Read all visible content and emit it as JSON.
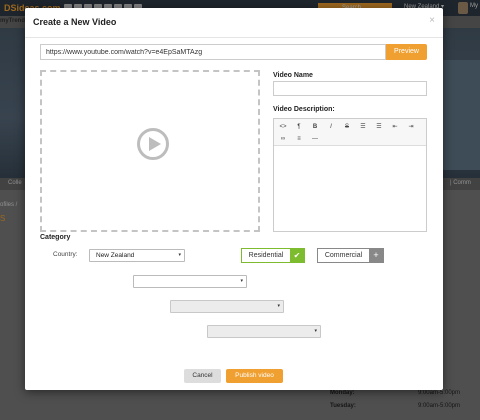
{
  "background": {
    "logo": "DSideas.com",
    "search_label": "Search",
    "country": "New Zealand ▾",
    "user": "My",
    "nav_label": "myTrends",
    "tab_left": "Colle",
    "tab_right": "| Comm",
    "crumb": "ofiles / ",
    "side_mark": "S",
    "hours": [
      {
        "day": "Monday:",
        "time": "9:00am-5:00pm"
      },
      {
        "day": "Tuesday:",
        "time": "9:00am-5:00pm"
      }
    ]
  },
  "modal": {
    "title": "Create a New Video",
    "close_glyph": "×",
    "url_value": "https://www.youtube.com/watch?v=e4EpSaMTAzg",
    "preview_label": "Preview",
    "video_name_label": "Video Name",
    "video_name_value": "",
    "video_description_label": "Video Description:",
    "editor_toolbar": [
      {
        "icon": "code-icon",
        "glyph": "<>"
      },
      {
        "icon": "paragraph-icon",
        "glyph": "¶"
      },
      {
        "icon": "bold-icon",
        "glyph": "B"
      },
      {
        "icon": "italic-icon",
        "glyph": "I"
      },
      {
        "icon": "strikethrough-icon",
        "glyph": "S"
      },
      {
        "icon": "unordered-list-icon",
        "glyph": "☰"
      },
      {
        "icon": "ordered-list-icon",
        "glyph": "☰"
      },
      {
        "icon": "outdent-icon",
        "glyph": "⇤"
      },
      {
        "icon": "indent-icon",
        "glyph": "⇥"
      },
      {
        "icon": "link-icon",
        "glyph": "∞"
      },
      {
        "icon": "align-icon",
        "glyph": "≡"
      },
      {
        "icon": "horizontal-rule-icon",
        "glyph": "—"
      }
    ],
    "category_title": "Category",
    "country_label": "Country:",
    "country_value": "New Zealand",
    "residential_label": "Residential",
    "commercial_label": "Commercial",
    "check_glyph": "✔",
    "plus_glyph": "+",
    "dropdown_arrow": "▾",
    "cancel_label": "Cancel",
    "publish_label": "Publish video"
  },
  "colors": {
    "accent": "#f0a030",
    "residential_active": "#7dbb2f",
    "commercial_inactive": "#888888"
  }
}
